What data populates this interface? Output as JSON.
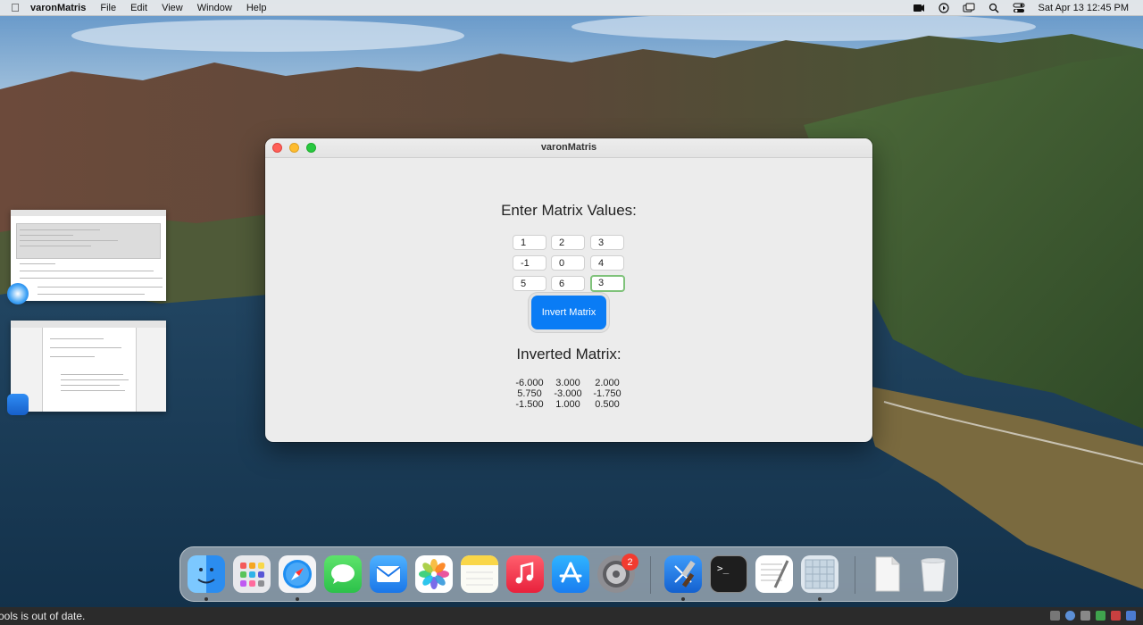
{
  "menubar": {
    "app_name": "varonMatris",
    "items": [
      "File",
      "Edit",
      "View",
      "Window",
      "Help"
    ],
    "datetime": "Sat Apr 13  12:45 PM",
    "status_icons": [
      "screen-record-icon",
      "play-circle-icon",
      "window-switcher-icon",
      "search-icon",
      "control-center-icon"
    ]
  },
  "window": {
    "title": "varonMatris",
    "enter_heading": "Enter Matrix Values:",
    "matrix_inputs": [
      [
        "1",
        "2",
        "3"
      ],
      [
        "-1",
        "0",
        "4"
      ],
      [
        "5",
        "6",
        "3"
      ]
    ],
    "button_label": "Invert Matrix",
    "result_heading": "Inverted Matrix:",
    "result": [
      [
        "-6.000",
        "3.000",
        "2.000"
      ],
      [
        "5.750",
        "-3.000",
        "-1.750"
      ],
      [
        "-1.500",
        "1.000",
        "0.500"
      ]
    ]
  },
  "dock": {
    "apps": [
      "finder-icon",
      "launchpad-icon",
      "safari-icon",
      "messages-icon",
      "mail-icon",
      "photos-icon",
      "notes-icon",
      "music-icon",
      "app-store-icon",
      "system-preferences-icon",
      "xcode-icon",
      "terminal-icon",
      "textedit-icon",
      "preview-icon",
      "document-icon",
      "trash-icon"
    ],
    "system_preferences_badge": "2"
  },
  "statusbar": {
    "text": "ools is out of date."
  },
  "colors": {
    "accent_button": "#0a7cf5",
    "focus_ring": "#7fc27a",
    "badge": "#f23b30"
  }
}
